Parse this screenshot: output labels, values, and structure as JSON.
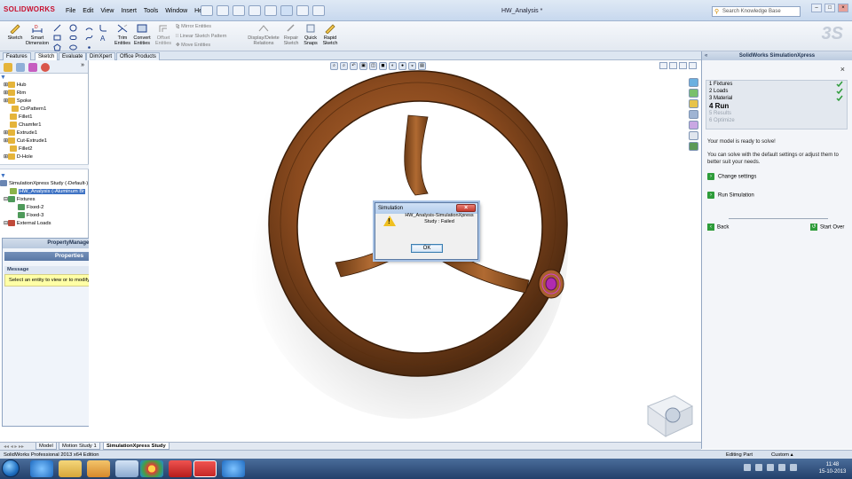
{
  "app": {
    "logo": "SOLIDWORKS",
    "doc_title": "HW_Analysis *"
  },
  "menu": [
    "File",
    "Edit",
    "View",
    "Insert",
    "Tools",
    "Window",
    "Help"
  ],
  "search": {
    "placeholder": "Search Knowledge Base"
  },
  "commands": {
    "sketch": "Sketch",
    "smart_dimension": "Smart\nDimension",
    "trim": "Trim\nEntities",
    "convert": "Convert\nEntities",
    "offset": "Offset\nEntities",
    "mirror": "Mirror Entities",
    "linear_pattern": "Linear Sketch Pattern",
    "move": "Move Entities",
    "display_delete": "Display/Delete\nRelations",
    "repair": "Repair\nSketch",
    "quick_snaps": "Quick\nSnaps",
    "rapid": "Rapid\nSketch"
  },
  "tabs": [
    "Features",
    "Sketch",
    "Evaluate",
    "DimXpert",
    "Office Products"
  ],
  "tree": {
    "items": [
      "Hub",
      "Rim",
      "Spoke",
      "CirPattern1",
      "Fillet1",
      "Chamfer1",
      "Extrude1",
      "Cut-Extrude1",
      "Fillet2",
      "D-Hole"
    ],
    "study": "SimulationXpress Study (-Default-)",
    "part": "HW_Analysis (-Aluminum Br",
    "fixtures": "Fixtures",
    "fixed2": "Fixed-2",
    "fixed3": "Fixed-3",
    "loads": "External Loads"
  },
  "propmgr": {
    "title": "PropertyManager",
    "properties": "Properties",
    "message_header": "Message",
    "message": "Select an entity to view or to modify its properties."
  },
  "dialog": {
    "title": "Simulation",
    "message_line1": "HW_Analysis-SimulationXpress",
    "message_line2": "Study : Failed",
    "ok": "OK"
  },
  "taskpane": {
    "title": "SolidWorks SimulationXpress",
    "steps": [
      {
        "label": "1  Fixtures",
        "state": "done"
      },
      {
        "label": "2  Loads",
        "state": "done"
      },
      {
        "label": "3  Material",
        "state": "done"
      },
      {
        "label": "4  Run",
        "state": "current"
      },
      {
        "label": "5  Results",
        "state": "disabled"
      },
      {
        "label": "6  Optimize",
        "state": "disabled"
      }
    ],
    "ready_text": "Your model is ready to solve!",
    "info_text": "You can solve with the default settings or adjust them to better suit your needs.",
    "change_settings": "Change settings",
    "run_simulation": "Run Simulation",
    "back": "Back",
    "start_over": "Start Over"
  },
  "bottom_tabs": [
    "Model",
    "Motion Study 1",
    "SimulationXpress Study"
  ],
  "status": {
    "edition": "SolidWorks Professional 2013 x64 Edition",
    "mode": "Editing Part",
    "units": "Custom"
  },
  "clock": {
    "time": "11:48",
    "date": "15-10-2013"
  },
  "colors": {
    "wheel": "#8a4a1e",
    "accent": "#3f73c4",
    "check": "#2e9c3a"
  }
}
